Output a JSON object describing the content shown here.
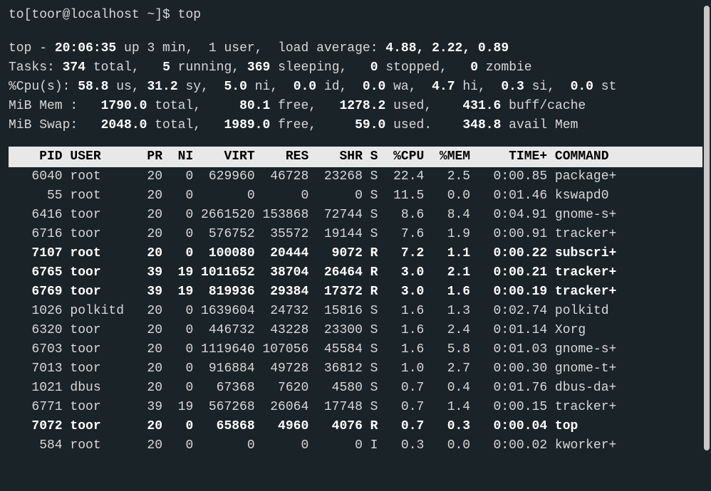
{
  "prompt": "to[toor@localhost ~]$ top",
  "summary": {
    "line1_pre": "top - ",
    "time": "20:06:35",
    "line1_mid": " up 3 min,  1 user,  load average: ",
    "load": "4.88, 2.22, 0.89",
    "tasks_label": "Tasks: ",
    "tasks_total": "374",
    "tasks_total_lbl": " total,   ",
    "tasks_running": "5",
    "tasks_running_lbl": " running, ",
    "tasks_sleeping": "369",
    "tasks_sleeping_lbl": " sleeping,   ",
    "tasks_stopped": "0",
    "tasks_stopped_lbl": " stopped,   ",
    "tasks_zombie": "0",
    "tasks_zombie_lbl": " zombie",
    "cpu_label": "%Cpu(s): ",
    "cpu_us": "58.8",
    "cpu_us_lbl": " us, ",
    "cpu_sy": "31.2",
    "cpu_sy_lbl": " sy,  ",
    "cpu_ni": "5.0",
    "cpu_ni_lbl": " ni,  ",
    "cpu_id": "0.0",
    "cpu_id_lbl": " id,  ",
    "cpu_wa": "0.0",
    "cpu_wa_lbl": " wa,  ",
    "cpu_hi": "4.7",
    "cpu_hi_lbl": " hi,  ",
    "cpu_si": "0.3",
    "cpu_si_lbl": " si,  ",
    "cpu_st": "0.0",
    "cpu_st_lbl": " st",
    "mem_label": "MiB Mem :   ",
    "mem_total": "1790.0",
    "mem_total_lbl": " total,     ",
    "mem_free": "80.1",
    "mem_free_lbl": " free,   ",
    "mem_used": "1278.2",
    "mem_used_lbl": " used,    ",
    "mem_buff": "431.6",
    "mem_buff_lbl": " buff/cache",
    "swap_label": "MiB Swap:   ",
    "swap_total": "2048.0",
    "swap_total_lbl": " total,   ",
    "swap_free": "1989.0",
    "swap_free_lbl": " free,     ",
    "swap_used": "59.0",
    "swap_used_lbl": " used.    ",
    "swap_avail": "348.8",
    "swap_avail_lbl": " avail Mem"
  },
  "header": "    PID USER      PR  NI    VIRT    RES    SHR S  %CPU  %MEM     TIME+ COMMAND ",
  "processes": [
    {
      "bold": false,
      "line": "   6040 root      20   0  629960  46728  23268 S  22.4   2.5   0:00.85 package+"
    },
    {
      "bold": false,
      "line": "     55 root      20   0       0      0      0 S  11.5   0.0   0:01.46 kswapd0"
    },
    {
      "bold": false,
      "line": "   6416 toor      20   0 2661520 153868  72744 S   8.6   8.4   0:04.91 gnome-s+"
    },
    {
      "bold": false,
      "line": "   6716 toor      20   0  576752  35572  19144 S   7.6   1.9   0:00.91 tracker+"
    },
    {
      "bold": true,
      "line": "   7107 root      20   0  100080  20444   9072 R   7.2   1.1   0:00.22 subscri+"
    },
    {
      "bold": true,
      "line": "   6765 toor      39  19 1011652  38704  26464 R   3.0   2.1   0:00.21 tracker+"
    },
    {
      "bold": true,
      "line": "   6769 toor      39  19  819936  29384  17372 R   3.0   1.6   0:00.19 tracker+"
    },
    {
      "bold": false,
      "line": "   1026 polkitd   20   0 1639604  24732  15816 S   1.6   1.3   0:02.74 polkitd"
    },
    {
      "bold": false,
      "line": "   6320 toor      20   0  446732  43228  23300 S   1.6   2.4   0:01.14 Xorg"
    },
    {
      "bold": false,
      "line": "   6703 toor      20   0 1119640 107056  45584 S   1.6   5.8   0:01.03 gnome-s+"
    },
    {
      "bold": false,
      "line": "   7013 toor      20   0  916884  49728  36812 S   1.0   2.7   0:00.30 gnome-t+"
    },
    {
      "bold": false,
      "line": "   1021 dbus      20   0   67368   7620   4580 S   0.7   0.4   0:01.76 dbus-da+"
    },
    {
      "bold": false,
      "line": "   6771 toor      39  19  567268  26064  17748 S   0.7   1.4   0:00.15 tracker+"
    },
    {
      "bold": true,
      "line": "   7072 toor      20   0   65868   4960   4076 R   0.7   0.3   0:00.04 top"
    },
    {
      "bold": false,
      "line": "    584 root      20   0       0      0      0 I   0.3   0.0   0:00.02 kworker+"
    }
  ]
}
